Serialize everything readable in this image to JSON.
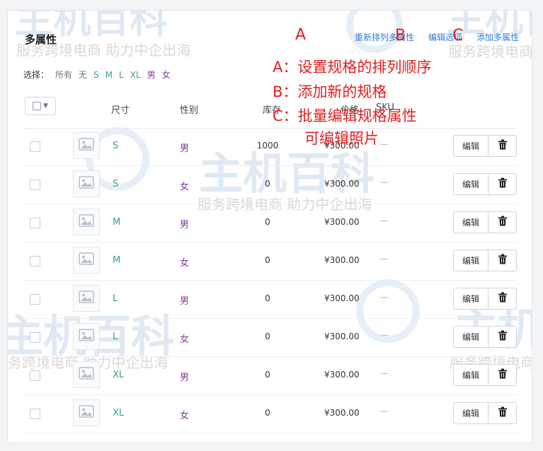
{
  "panel": {
    "title": "多属性"
  },
  "actions": {
    "reorder_label": "重新排列多属性",
    "edit_options_label": "编辑选项",
    "add_label": "添加多属性"
  },
  "filter": {
    "label": "选择：",
    "all": "所有",
    "none": "无",
    "sizes": [
      "S",
      "M",
      "L",
      "XL"
    ],
    "genders": [
      "男",
      "女"
    ]
  },
  "table": {
    "headers": {
      "size": "尺寸",
      "gender": "性别",
      "stock": "库存",
      "price": "价格",
      "sku": "SKU"
    },
    "rows": [
      {
        "size": "S",
        "gender": "男",
        "stock": "1000",
        "price": "¥300.00",
        "sku": "—"
      },
      {
        "size": "S",
        "gender": "女",
        "stock": "0",
        "price": "¥300.00",
        "sku": "—"
      },
      {
        "size": "M",
        "gender": "男",
        "stock": "0",
        "price": "¥300.00",
        "sku": "—"
      },
      {
        "size": "M",
        "gender": "女",
        "stock": "0",
        "price": "¥300.00",
        "sku": "—"
      },
      {
        "size": "L",
        "gender": "男",
        "stock": "0",
        "price": "¥300.00",
        "sku": "—"
      },
      {
        "size": "L",
        "gender": "女",
        "stock": "0",
        "price": "¥300.00",
        "sku": "—"
      },
      {
        "size": "XL",
        "gender": "男",
        "stock": "0",
        "price": "¥300.00",
        "sku": "—"
      },
      {
        "size": "XL",
        "gender": "女",
        "stock": "0",
        "price": "¥300.00",
        "sku": "—"
      }
    ],
    "edit_label": "编辑"
  },
  "annotations": {
    "a_letter": "A",
    "b_letter": "B",
    "c_letter": "C",
    "a_text": "A：设置规格的排列顺序",
    "b_text": "B：添加新的规格",
    "c_text_1": "C：批量编辑规格属性",
    "c_text_2": "可编辑照片"
  },
  "watermark": {
    "brand": "主机百科",
    "slogan": "服务跨境电商 助力中企出海"
  },
  "colors": {
    "link": "#2e7bd6",
    "size_value": "#35a96c",
    "gender_value": "#7c3c9c",
    "annotation": "#e02020"
  },
  "icons": {
    "image_placeholder": "image-placeholder-icon",
    "delete": "trash-icon",
    "dropdown": "caret-down-icon"
  }
}
